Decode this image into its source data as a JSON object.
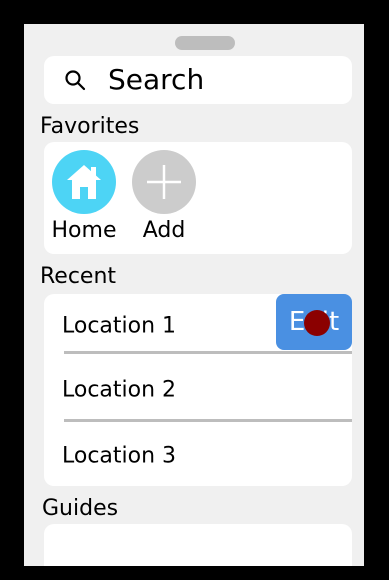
{
  "search": {
    "placeholder": "Search",
    "icon": "search-icon"
  },
  "favorites": {
    "label": "Favorites",
    "items": [
      {
        "label": "Home",
        "icon": "home-icon",
        "color": "#4dd4f5"
      },
      {
        "label": "Add",
        "icon": "plus-icon",
        "color": "#cccccc"
      }
    ]
  },
  "recent": {
    "label": "Recent",
    "items": [
      {
        "label": "Location 1"
      },
      {
        "label": "Location 2"
      },
      {
        "label": "Location 3"
      }
    ],
    "edit_label": "Edit"
  },
  "guides": {
    "label": "Guides"
  },
  "colors": {
    "accent": "#4a90e2",
    "cursor": "#8b0000"
  }
}
